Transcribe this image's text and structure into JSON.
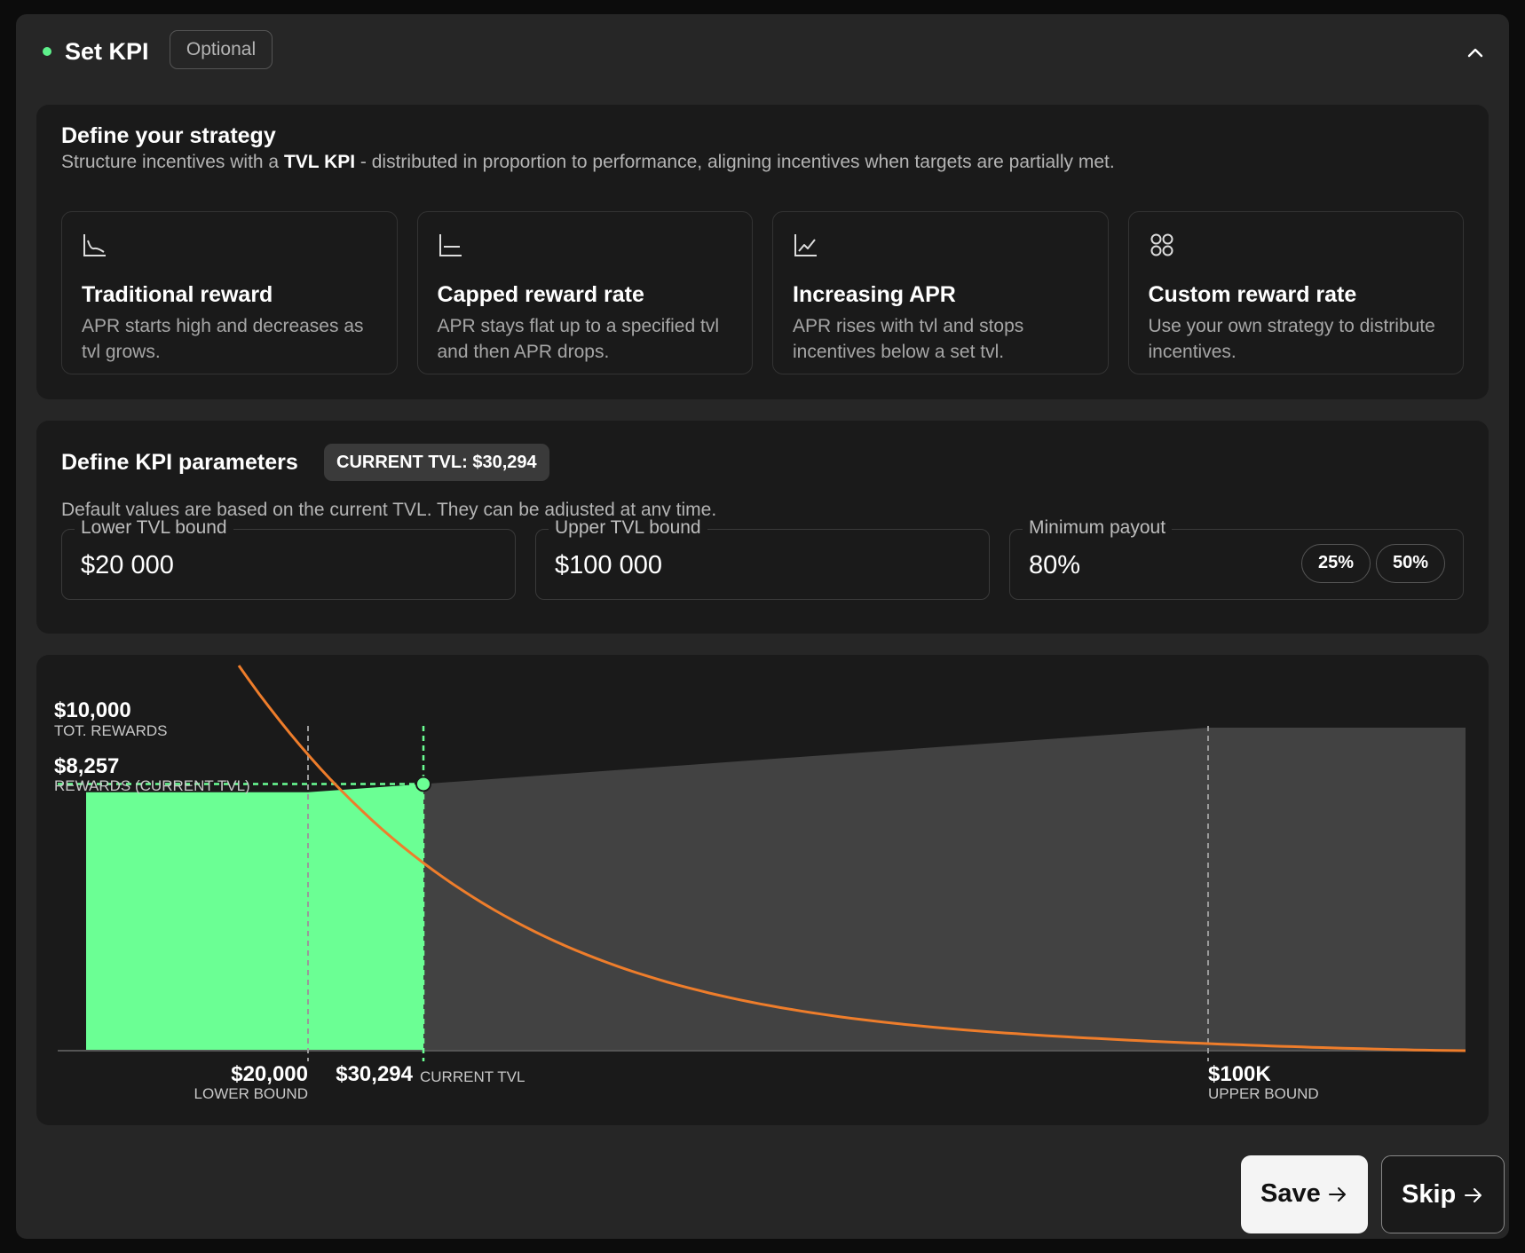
{
  "header": {
    "title": "Set KPI",
    "badge": "Optional"
  },
  "strategy": {
    "title": "Define your strategy",
    "desc_pre": "Structure incentives with a ",
    "desc_bold": "TVL KPI",
    "desc_post": " - distributed in proportion to performance, aligning incentives when targets are partially met.",
    "options": [
      {
        "icon": "chart-decreasing-icon",
        "title": "Traditional reward",
        "desc": "APR starts high and decreases as tvl grows."
      },
      {
        "icon": "chart-capped-icon",
        "title": "Capped reward rate",
        "desc": "APR stays flat up to a specified tvl and then APR drops."
      },
      {
        "icon": "chart-increasing-icon",
        "title": "Increasing APR",
        "desc": "APR rises with tvl and stops incentives below a set tvl."
      },
      {
        "icon": "grid-circles-icon",
        "title": "Custom reward rate",
        "desc": "Use your own strategy to distribute incentives."
      }
    ]
  },
  "kpi": {
    "title": "Define KPI parameters",
    "current_tvl_badge": "CURRENT TVL: $30,294",
    "desc": "Default values are based on the current TVL. They can be adjusted at any time.",
    "fields": [
      {
        "label": "Lower TVL bound",
        "value": "$20 000"
      },
      {
        "label": "Upper TVL bound",
        "value": "$100 000"
      },
      {
        "label": "Minimum payout",
        "value": "80%"
      }
    ],
    "payout_options": [
      "25%",
      "50%"
    ]
  },
  "chart_data": {
    "type": "area",
    "x": [
      0,
      20000,
      30294,
      100000,
      120000
    ],
    "rewards": [
      8000,
      8000,
      8257,
      10000,
      10000
    ],
    "current_tvl": 30294,
    "lower_bound": 20000,
    "upper_bound": 100000,
    "total_rewards": 10000,
    "current_rewards": 8257,
    "apr_curve_note_free": true,
    "labels": {
      "total_value": "$10,000",
      "total_caption": "TOT. REWARDS",
      "current_value": "$8,257",
      "current_caption": "REWARDS (CURRENT TVL)",
      "lower_value": "$20,000",
      "lower_caption": "LOWER BOUND",
      "current_tvl_value": "$30,294",
      "current_tvl_caption": "CURRENT TVL",
      "upper_value": "$100K",
      "upper_caption": "UPPER BOUND"
    },
    "colors": {
      "achieved": "#6bff94",
      "remaining": "#424242",
      "apr_curve": "#ee7d2b"
    }
  },
  "actions": {
    "save": "Save",
    "skip": "Skip"
  }
}
